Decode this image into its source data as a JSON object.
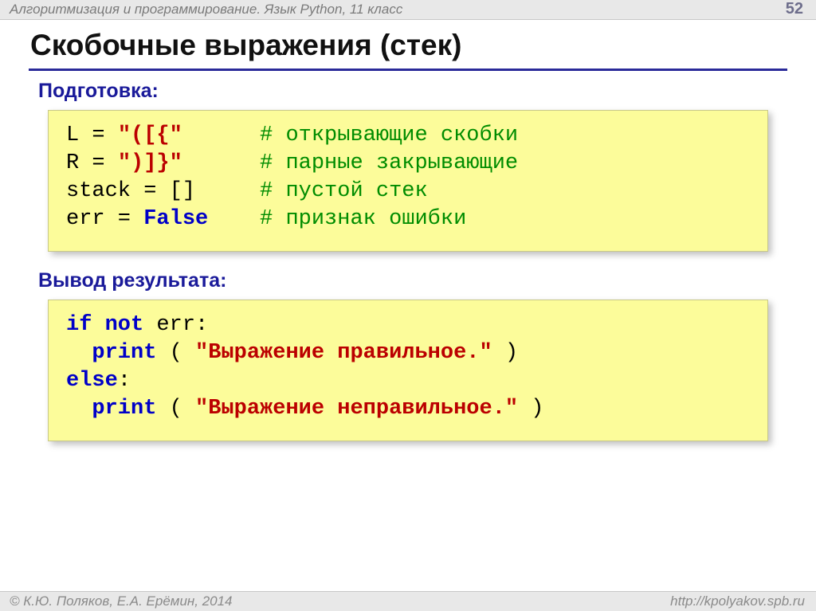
{
  "header": {
    "course_title": "Алгоритмизация и программирование. Язык Python, 11 класс",
    "page_number": "52"
  },
  "title": "Скобочные выражения (стек)",
  "sections": {
    "prep_label": "Подготовка:",
    "result_label": "Вывод результата:"
  },
  "code1": {
    "l_lhs": "L",
    "eq": " = ",
    "l_str": "\"([{\"",
    "l_cmt": "# открывающие скобки",
    "r_lhs": "R",
    "r_str": "\")]}\"",
    "r_cmt": "# парные закрывающие",
    "stack_lhs": "stack",
    "stack_rhs": "[]",
    "stack_cmt": "# пустой стек",
    "err_lhs": "err",
    "err_rhs_kw": "False",
    "err_cmt": "# признак ошибки"
  },
  "code2": {
    "kw_if": "if",
    "kw_not": "not",
    "err_id": " err:",
    "print_fn": "print",
    "msg_ok": "\"Выражение правильное.\"",
    "kw_else": "else",
    "colon": ":",
    "msg_bad": "\"Выражение неправильное.\"",
    "open_paren": " ( ",
    "close_paren": " )"
  },
  "footer": {
    "copyright": "© К.Ю. Поляков, Е.А. Ерёмин, 2014",
    "url": "http://kpolyakov.spb.ru"
  }
}
